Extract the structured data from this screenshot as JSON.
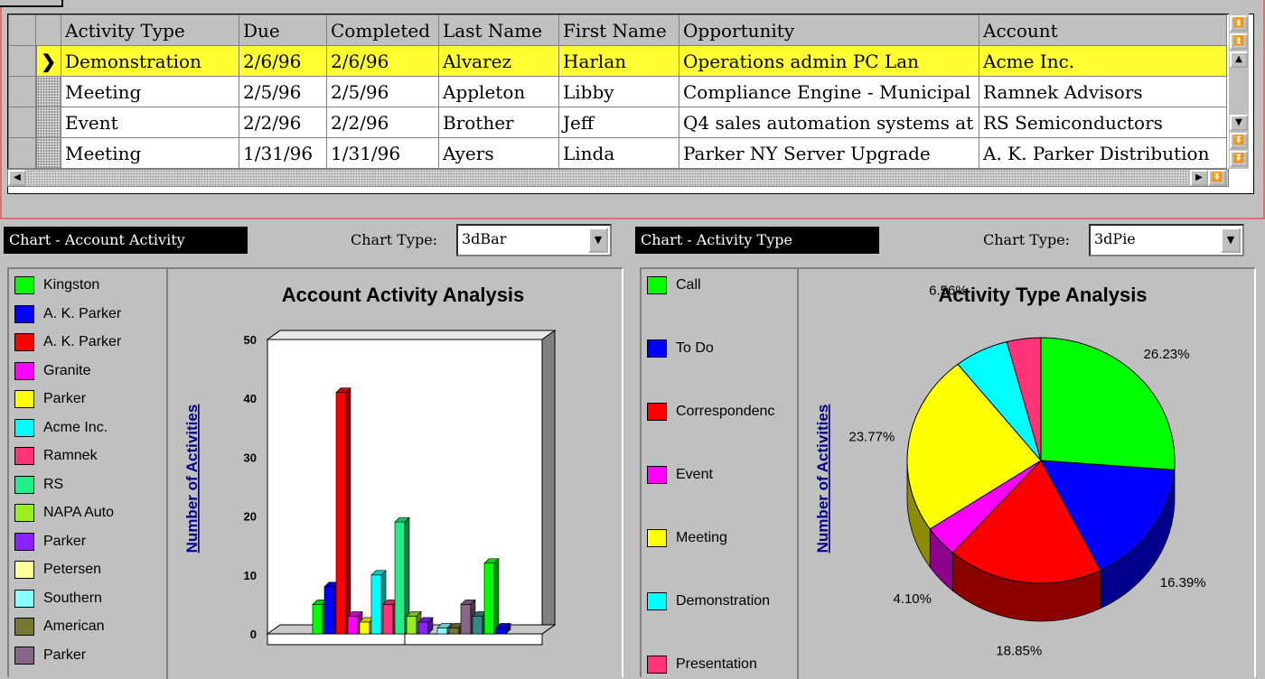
{
  "grid": {
    "columns": [
      "Activity Type",
      "Due",
      "Completed",
      "Last Name",
      "First Name",
      "Opportunity",
      "Account"
    ],
    "rows": [
      {
        "cells": [
          "Demonstration",
          "2/6/96",
          "2/6/96",
          "Alvarez",
          "Harlan",
          "Operations admin PC Lan",
          "Acme Inc."
        ],
        "selected": true
      },
      {
        "cells": [
          "Meeting",
          "2/5/96",
          "2/5/96",
          "Appleton",
          "Libby",
          "Compliance Engine - Municipal",
          "Ramnek Advisors"
        ],
        "selected": false
      },
      {
        "cells": [
          "Event",
          "2/2/96",
          "2/2/96",
          "Brother",
          "Jeff",
          "Q4 sales automation systems at",
          "RS Semiconductors"
        ],
        "selected": false
      },
      {
        "cells": [
          "Meeting",
          "1/31/96",
          "1/31/96",
          "Ayers",
          "Linda",
          "Parker NY Server Upgrade",
          "A. K. Parker Distribution"
        ],
        "selected": false
      }
    ],
    "selected_indicator": "❯"
  },
  "left_panel": {
    "header": "Chart - Account Activity",
    "chart_type_label": "Chart Type:",
    "chart_type_value": "3dBar",
    "legend": [
      {
        "label": "Kingston",
        "color": "#00ff00"
      },
      {
        "label": "A. K. Parker",
        "color": "#0000ff"
      },
      {
        "label": "A. K. Parker",
        "color": "#ff0000"
      },
      {
        "label": "Granite",
        "color": "#ff00ff"
      },
      {
        "label": "Parker",
        "color": "#ffff00"
      },
      {
        "label": "Acme Inc.",
        "color": "#00ffff"
      },
      {
        "label": "Ramnek",
        "color": "#ff3377"
      },
      {
        "label": "RS",
        "color": "#22ee88"
      },
      {
        "label": "NAPA Auto",
        "color": "#99ee22"
      },
      {
        "label": "Parker",
        "color": "#8822ff"
      },
      {
        "label": "Petersen",
        "color": "#ffff99"
      },
      {
        "label": "Southern",
        "color": "#88ffff"
      },
      {
        "label": "American",
        "color": "#777733"
      },
      {
        "label": "Parker",
        "color": "#886688"
      }
    ]
  },
  "right_panel": {
    "header": "Chart - Activity Type",
    "chart_type_label": "Chart Type:",
    "chart_type_value": "3dPie",
    "legend": [
      {
        "label": "Call",
        "color": "#00ff00"
      },
      {
        "label": "To Do",
        "color": "#0000ff"
      },
      {
        "label": "Correspondenc",
        "color": "#ff0000"
      },
      {
        "label": "Event",
        "color": "#ff00ff"
      },
      {
        "label": "Meeting",
        "color": "#ffff00"
      },
      {
        "label": "Demonstration",
        "color": "#00ffff"
      },
      {
        "label": "Presentation",
        "color": "#ff3377"
      }
    ]
  },
  "chart_data": [
    {
      "type": "bar",
      "title": "Account Activity Analysis",
      "ylabel": "Number of Activities",
      "xlabel": "",
      "ylim": [
        0,
        50
      ],
      "yticks": [
        "0",
        "10",
        "20",
        "30",
        "40",
        "50"
      ],
      "groups": [
        {
          "values": [
            5,
            8,
            41,
            3,
            2,
            10,
            5,
            19,
            3,
            2
          ]
        },
        {
          "values": [
            1,
            1,
            5,
            3,
            12,
            1
          ]
        }
      ],
      "group1_colors": [
        "#00ff00",
        "#0000ff",
        "#ff0000",
        "#ff00ff",
        "#ffff00",
        "#00ffff",
        "#ff3377",
        "#22ee88",
        "#99ee22",
        "#8822ff"
      ],
      "group2_colors": [
        "#88ffff",
        "#777733",
        "#886688",
        "#338888",
        "#00ff00",
        "#0000ff"
      ]
    },
    {
      "type": "pie",
      "title": "Activity Type Analysis",
      "ylabel": "Number of Activities",
      "slices": [
        {
          "label": "Call",
          "value": 26.23,
          "text": "26.23%",
          "color": "#00ff00"
        },
        {
          "label": "To Do",
          "value": 16.39,
          "text": "16.39%",
          "color": "#0000ff"
        },
        {
          "label": "Correspondenc",
          "value": 18.85,
          "text": "18.85%",
          "color": "#ff0000"
        },
        {
          "label": "Event",
          "value": 4.1,
          "text": "4.10%",
          "color": "#ff00ff"
        },
        {
          "label": "Meeting",
          "value": 23.77,
          "text": "23.77%",
          "color": "#ffff00"
        },
        {
          "label": "Demonstration",
          "value": 6.56,
          "text": "6.56%",
          "color": "#00ffff"
        },
        {
          "label": "Presentation",
          "value": 4.1,
          "text": "4.10%",
          "color": "#ff3377"
        }
      ]
    }
  ]
}
